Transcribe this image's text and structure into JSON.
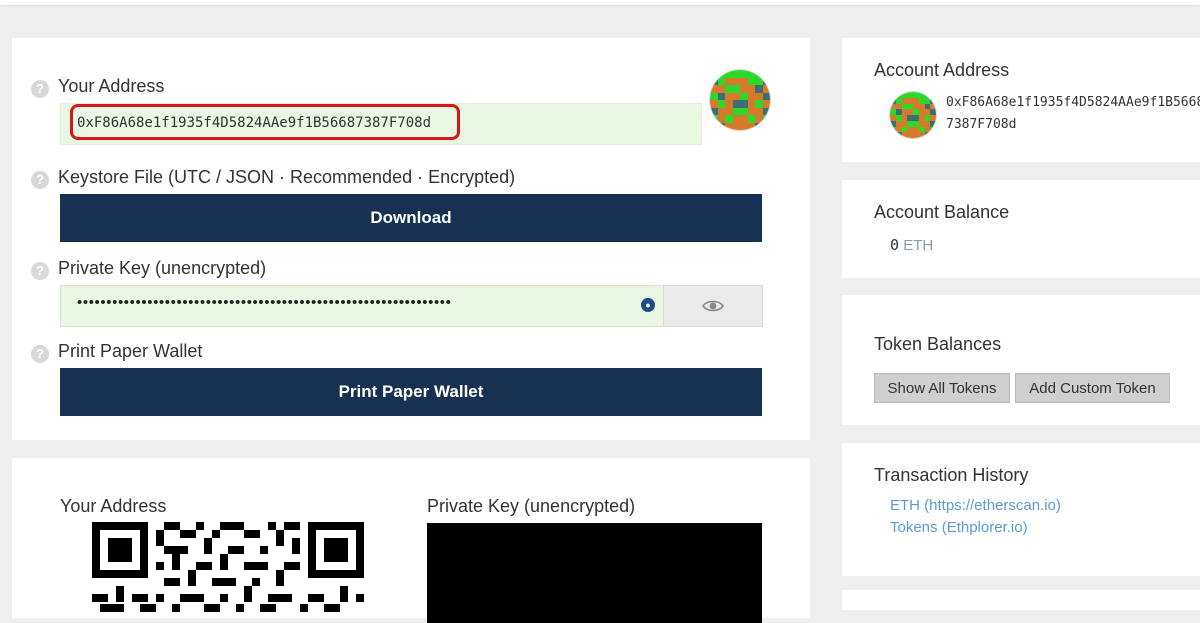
{
  "wallet": {
    "your_address_label": "Your Address",
    "address": "0xF86A68e1f1935f4D5824AAe9f1B56687387F708d",
    "keystore_label": "Keystore File (UTC / JSON · Recommended · Encrypted)",
    "download_button": "Download",
    "private_key_label": "Private Key (unencrypted)",
    "private_key_masked": "••••••••••••••••••••••••••••••••••••••••••••••••••••••••••••••••",
    "paper_wallet_label": "Print Paper Wallet",
    "paper_wallet_button": "Print Paper Wallet",
    "help_glyph": "?"
  },
  "print_section": {
    "address_label": "Your Address",
    "private_key_label": "Private Key (unencrypted)"
  },
  "sidebar": {
    "account_address": {
      "title": "Account Address",
      "address": "0xF86A68e1f1935f4D5824AAe9f1B56687387F708d"
    },
    "account_balance": {
      "title": "Account Balance",
      "amount": "0",
      "unit": "ETH"
    },
    "token_balances": {
      "title": "Token Balances",
      "show_all_button": "Show All Tokens",
      "add_custom_button": "Add Custom Token"
    },
    "transaction_history": {
      "title": "Transaction History",
      "links": [
        "ETH (https://etherscan.io)",
        "Tokens (Ethplorer.io)"
      ]
    }
  },
  "colors": {
    "primary_button": "#163151",
    "address_bg": "#e9f7e3",
    "highlight": "#d9151c",
    "link": "#5b9bd1"
  },
  "icons": [
    "help-icon",
    "eye-icon",
    "lock-icon",
    "identicon",
    "qr-code"
  ]
}
